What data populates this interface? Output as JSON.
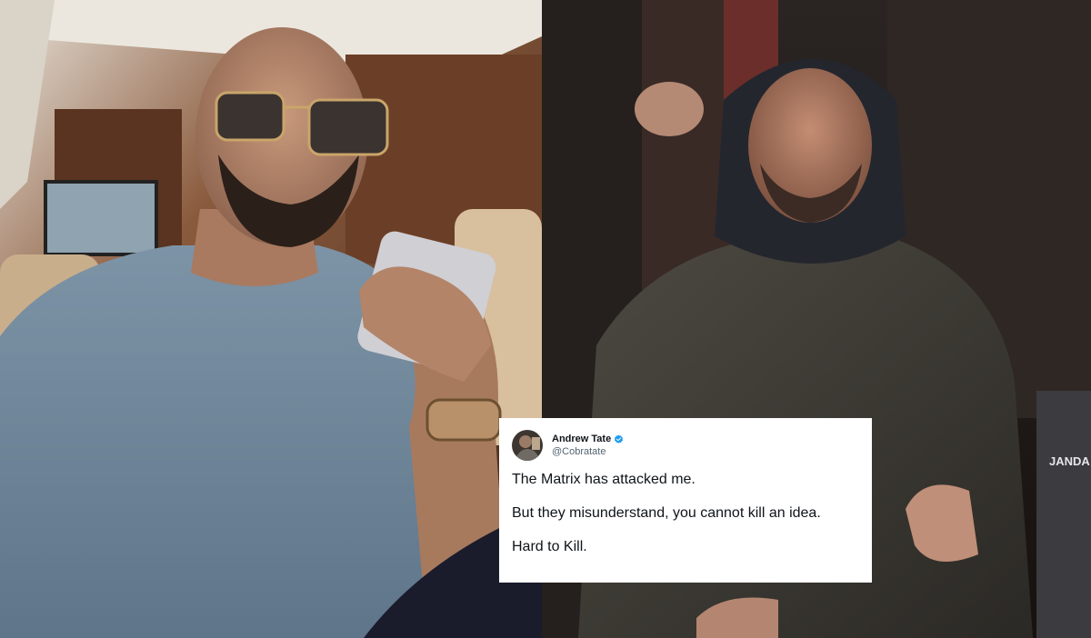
{
  "left_photo": {
    "subject": "man in blue t-shirt and sunglasses looking at phone inside private jet"
  },
  "right_photo": {
    "subject": "man in dark hooded jacket escorted by uniformed officers at night",
    "uniform_patch": "JANDA"
  },
  "tweet": {
    "display_name": "Andrew Tate",
    "handle": "@Cobratate",
    "verified_color": "#1d9bf0",
    "lines": [
      "The Matrix has attacked me.",
      "But they misunderstand, you cannot kill an idea.",
      "Hard to Kill."
    ]
  }
}
